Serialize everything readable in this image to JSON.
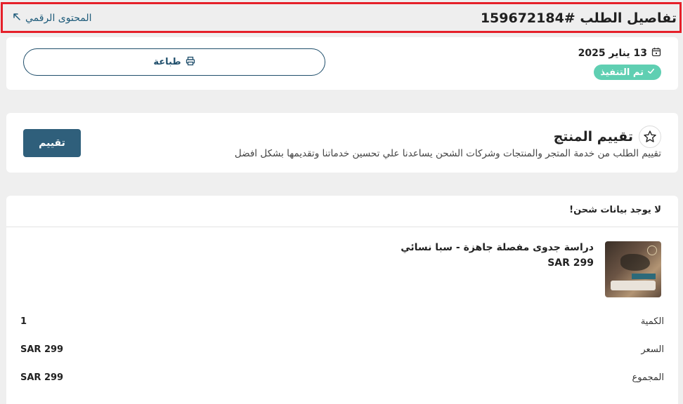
{
  "header": {
    "title": "تفاصيل الطلب #159672184",
    "digital_content_link": "المحتوى الرقمي"
  },
  "order_info": {
    "print_label": "طباعة",
    "date": "13 يناير 2025",
    "status": "تم التنفيذ",
    "status_color": "#5fcfb2"
  },
  "rating": {
    "title": "تقييم المنتج",
    "description": "تقييم الطلب من خدمة المتجر والمنتجات وشركات الشحن يساعدنا علي تحسين خدماتنا وتقديمها بشكل افضل",
    "button_label": "تقييم",
    "button_color": "#2f5f7b"
  },
  "shipping": {
    "no_data": "لا يوجد بيانات شحن!"
  },
  "product": {
    "name": "دراسة جدوى مفصلة جاهزة - سبا نسائي",
    "price": "SAR 299",
    "details": {
      "quantity_label": "الكمية",
      "quantity_value": "1",
      "price_label": "السعر",
      "price_value": "SAR 299",
      "total_label": "المجموع",
      "total_value": "SAR 299"
    }
  },
  "colors": {
    "accent": "#1f4e6b",
    "highlight_border": "#e5202a"
  }
}
